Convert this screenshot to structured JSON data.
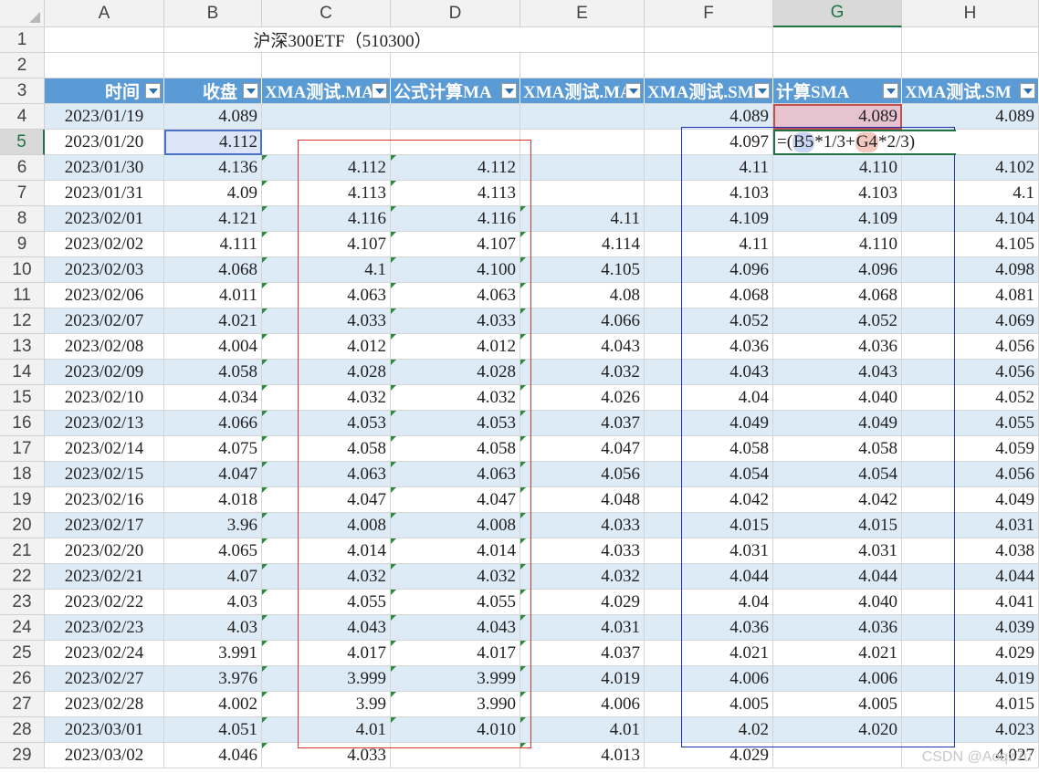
{
  "columns": [
    "A",
    "B",
    "C",
    "D",
    "E",
    "F",
    "G",
    "H"
  ],
  "selected_column": "G",
  "selected_row": 5,
  "title": "沪深300ETF（510300）",
  "header_row": {
    "A": "时间",
    "B": "收盘",
    "C": "XMA测试.MA",
    "D": "公式计算MA",
    "E": "XMA测试.MA",
    "F": "XMA测试.SM",
    "G": "计算SMA",
    "H": "XMA测试.SM"
  },
  "active_formula": {
    "prefix": "=(",
    "ref1": "B5",
    "mid": "*1/3+",
    "ref2": "G4",
    "suffix": "*2/3)"
  },
  "rows": [
    {
      "n": 4,
      "A": "2023/01/19",
      "B": "4.089",
      "C": "",
      "D": "",
      "E": "",
      "F": "4.089",
      "G": "4.089",
      "H": "4.089"
    },
    {
      "n": 5,
      "A": "2023/01/20",
      "B": "4.112",
      "C": "",
      "D": "",
      "E": "",
      "F": "4.097",
      "G": "",
      "H": ""
    },
    {
      "n": 6,
      "A": "2023/01/30",
      "B": "4.136",
      "C": "4.112",
      "D": "4.112",
      "E": "",
      "F": "4.11",
      "G": "4.110",
      "H": "4.102"
    },
    {
      "n": 7,
      "A": "2023/01/31",
      "B": "4.09",
      "C": "4.113",
      "D": "4.113",
      "E": "",
      "F": "4.103",
      "G": "4.103",
      "H": "4.1"
    },
    {
      "n": 8,
      "A": "2023/02/01",
      "B": "4.121",
      "C": "4.116",
      "D": "4.116",
      "E": "4.11",
      "F": "4.109",
      "G": "4.109",
      "H": "4.104"
    },
    {
      "n": 9,
      "A": "2023/02/02",
      "B": "4.111",
      "C": "4.107",
      "D": "4.107",
      "E": "4.114",
      "F": "4.11",
      "G": "4.110",
      "H": "4.105"
    },
    {
      "n": 10,
      "A": "2023/02/03",
      "B": "4.068",
      "C": "4.1",
      "D": "4.100",
      "E": "4.105",
      "F": "4.096",
      "G": "4.096",
      "H": "4.098"
    },
    {
      "n": 11,
      "A": "2023/02/06",
      "B": "4.011",
      "C": "4.063",
      "D": "4.063",
      "E": "4.08",
      "F": "4.068",
      "G": "4.068",
      "H": "4.081"
    },
    {
      "n": 12,
      "A": "2023/02/07",
      "B": "4.021",
      "C": "4.033",
      "D": "4.033",
      "E": "4.066",
      "F": "4.052",
      "G": "4.052",
      "H": "4.069"
    },
    {
      "n": 13,
      "A": "2023/02/08",
      "B": "4.004",
      "C": "4.012",
      "D": "4.012",
      "E": "4.043",
      "F": "4.036",
      "G": "4.036",
      "H": "4.056"
    },
    {
      "n": 14,
      "A": "2023/02/09",
      "B": "4.058",
      "C": "4.028",
      "D": "4.028",
      "E": "4.032",
      "F": "4.043",
      "G": "4.043",
      "H": "4.056"
    },
    {
      "n": 15,
      "A": "2023/02/10",
      "B": "4.034",
      "C": "4.032",
      "D": "4.032",
      "E": "4.026",
      "F": "4.04",
      "G": "4.040",
      "H": "4.052"
    },
    {
      "n": 16,
      "A": "2023/02/13",
      "B": "4.066",
      "C": "4.053",
      "D": "4.053",
      "E": "4.037",
      "F": "4.049",
      "G": "4.049",
      "H": "4.055"
    },
    {
      "n": 17,
      "A": "2023/02/14",
      "B": "4.075",
      "C": "4.058",
      "D": "4.058",
      "E": "4.047",
      "F": "4.058",
      "G": "4.058",
      "H": "4.059"
    },
    {
      "n": 18,
      "A": "2023/02/15",
      "B": "4.047",
      "C": "4.063",
      "D": "4.063",
      "E": "4.056",
      "F": "4.054",
      "G": "4.054",
      "H": "4.056"
    },
    {
      "n": 19,
      "A": "2023/02/16",
      "B": "4.018",
      "C": "4.047",
      "D": "4.047",
      "E": "4.048",
      "F": "4.042",
      "G": "4.042",
      "H": "4.049"
    },
    {
      "n": 20,
      "A": "2023/02/17",
      "B": "3.96",
      "C": "4.008",
      "D": "4.008",
      "E": "4.033",
      "F": "4.015",
      "G": "4.015",
      "H": "4.031"
    },
    {
      "n": 21,
      "A": "2023/02/20",
      "B": "4.065",
      "C": "4.014",
      "D": "4.014",
      "E": "4.033",
      "F": "4.031",
      "G": "4.031",
      "H": "4.038"
    },
    {
      "n": 22,
      "A": "2023/02/21",
      "B": "4.07",
      "C": "4.032",
      "D": "4.032",
      "E": "4.032",
      "F": "4.044",
      "G": "4.044",
      "H": "4.044"
    },
    {
      "n": 23,
      "A": "2023/02/22",
      "B": "4.03",
      "C": "4.055",
      "D": "4.055",
      "E": "4.029",
      "F": "4.04",
      "G": "4.040",
      "H": "4.041"
    },
    {
      "n": 24,
      "A": "2023/02/23",
      "B": "4.03",
      "C": "4.043",
      "D": "4.043",
      "E": "4.031",
      "F": "4.036",
      "G": "4.036",
      "H": "4.039"
    },
    {
      "n": 25,
      "A": "2023/02/24",
      "B": "3.991",
      "C": "4.017",
      "D": "4.017",
      "E": "4.037",
      "F": "4.021",
      "G": "4.021",
      "H": "4.029"
    },
    {
      "n": 26,
      "A": "2023/02/27",
      "B": "3.976",
      "C": "3.999",
      "D": "3.999",
      "E": "4.019",
      "F": "4.006",
      "G": "4.006",
      "H": "4.019"
    },
    {
      "n": 27,
      "A": "2023/02/28",
      "B": "4.002",
      "C": "3.99",
      "D": "3.990",
      "E": "4.006",
      "F": "4.005",
      "G": "4.005",
      "H": "4.015"
    },
    {
      "n": 28,
      "A": "2023/03/01",
      "B": "4.051",
      "C": "4.01",
      "D": "4.010",
      "E": "4.01",
      "F": "4.02",
      "G": "4.020",
      "H": "4.023"
    },
    {
      "n": 29,
      "A": "2023/03/02",
      "B": "4.046",
      "C": "4.033",
      "D": "",
      "E": "4.013",
      "F": "4.029",
      "G": "",
      "H": "4.027"
    }
  ],
  "watermark": "CSDN @Aoqz7u",
  "colors": {
    "header_blue": "#5b9bd5",
    "band_blue": "#ddebf7",
    "red_box": "#d9322f",
    "blue_box": "#1f2fb8",
    "selection_green": "#217346"
  }
}
